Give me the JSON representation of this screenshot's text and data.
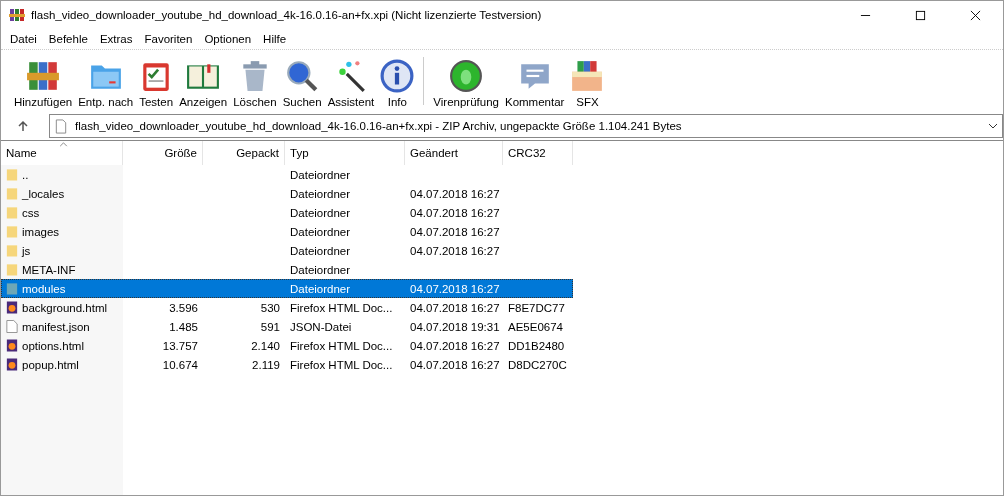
{
  "window": {
    "title": "flash_video_downloader_youtube_hd_download_4k-16.0.16-an+fx.xpi (Nicht lizenzierte Testversion)"
  },
  "menu": [
    "Datei",
    "Befehle",
    "Extras",
    "Favoriten",
    "Optionen",
    "Hilfe"
  ],
  "toolbar": [
    {
      "label": "Hinzufügen",
      "kind": "add"
    },
    {
      "label": "Entp. nach",
      "kind": "extract"
    },
    {
      "label": "Testen",
      "kind": "test"
    },
    {
      "label": "Anzeigen",
      "kind": "view"
    },
    {
      "label": "Löschen",
      "kind": "delete"
    },
    {
      "label": "Suchen",
      "kind": "find"
    },
    {
      "label": "Assistent",
      "kind": "wizard"
    },
    {
      "label": "Info",
      "kind": "info"
    },
    {
      "label": "Virenprüfung",
      "kind": "virus"
    },
    {
      "label": "Kommentar",
      "kind": "comment"
    },
    {
      "label": "SFX",
      "kind": "sfx"
    }
  ],
  "address": {
    "value": "flash_video_downloader_youtube_hd_download_4k-16.0.16-an+fx.xpi - ZIP Archiv, ungepackte Größe 1.104.241 Bytes"
  },
  "table": {
    "columns": [
      "Name",
      "Größe",
      "Gepackt",
      "Typ",
      "Geändert",
      "CRC32"
    ],
    "rows": [
      {
        "kind": "folder",
        "name": "..",
        "size": "",
        "packed": "",
        "type": "Dateiordner",
        "modified": "",
        "crc": "",
        "selected": false
      },
      {
        "kind": "folder",
        "name": "_locales",
        "size": "",
        "packed": "",
        "type": "Dateiordner",
        "modified": "04.07.2018 16:27",
        "crc": "",
        "selected": false
      },
      {
        "kind": "folder",
        "name": "css",
        "size": "",
        "packed": "",
        "type": "Dateiordner",
        "modified": "04.07.2018 16:27",
        "crc": "",
        "selected": false
      },
      {
        "kind": "folder",
        "name": "images",
        "size": "",
        "packed": "",
        "type": "Dateiordner",
        "modified": "04.07.2018 16:27",
        "crc": "",
        "selected": false
      },
      {
        "kind": "folder",
        "name": "js",
        "size": "",
        "packed": "",
        "type": "Dateiordner",
        "modified": "04.07.2018 16:27",
        "crc": "",
        "selected": false
      },
      {
        "kind": "folder",
        "name": "META-INF",
        "size": "",
        "packed": "",
        "type": "Dateiordner",
        "modified": "",
        "crc": "",
        "selected": false
      },
      {
        "kind": "folder",
        "name": "modules",
        "size": "",
        "packed": "",
        "type": "Dateiordner",
        "modified": "04.07.2018 16:27",
        "crc": "",
        "selected": true
      },
      {
        "kind": "html",
        "name": "background.html",
        "size": "3.596",
        "packed": "530",
        "type": "Firefox HTML Doc...",
        "modified": "04.07.2018 16:27",
        "crc": "F8E7DC77",
        "selected": false
      },
      {
        "kind": "file",
        "name": "manifest.json",
        "size": "1.485",
        "packed": "591",
        "type": "JSON-Datei",
        "modified": "04.07.2018 19:31",
        "crc": "AE5E0674",
        "selected": false
      },
      {
        "kind": "html",
        "name": "options.html",
        "size": "13.757",
        "packed": "2.140",
        "type": "Firefox HTML Doc...",
        "modified": "04.07.2018 16:27",
        "crc": "DD1B2480",
        "selected": false
      },
      {
        "kind": "html",
        "name": "popup.html",
        "size": "10.674",
        "packed": "2.119",
        "type": "Firefox HTML Doc...",
        "modified": "04.07.2018 16:27",
        "crc": "D8DC270C",
        "selected": false
      }
    ]
  }
}
